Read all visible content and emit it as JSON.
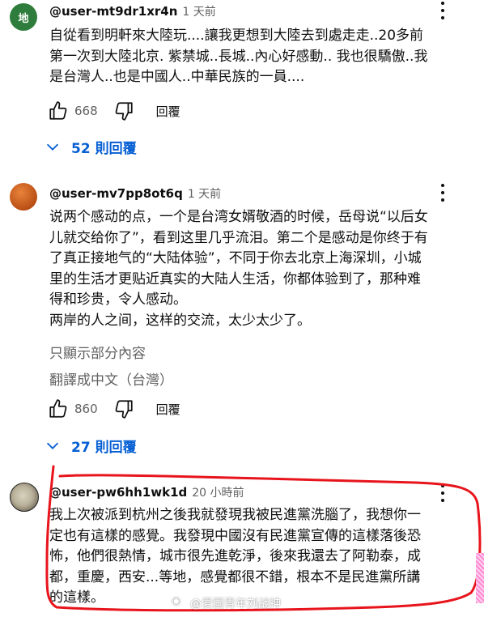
{
  "comments": [
    {
      "avatar_text": "地",
      "handle": "@user-mt9dr1xr4n",
      "time": "1 天前",
      "lines": [
        "自從看到明軒來大陸玩....讓我更想到大陸去到處走走..20多前",
        "第一次到大陸北京. 紫禁城..長城..內心好感動.. 我也很驕傲..我",
        "是台灣人..也是中國人..中華民族的一員...."
      ],
      "likes": "668",
      "reply_label": "回覆",
      "replies_label": "52 則回覆"
    },
    {
      "avatar_text": "",
      "handle": "@user-mv7pp8ot6q",
      "time": "1 天前",
      "lines": [
        "说两个感动的点，一个是台湾女婿敬酒的时候，岳母说“以后女",
        "儿就交给你了”，看到这里几乎流泪。第二个是感动是你终于有",
        "了真正接地气的“大陆体验”，不同于你去北京上海深圳，小城",
        "里的生活才更贴近真实的大陆人生活，你都体验到了，那种难",
        "得和珍贵，令人感动。",
        "两岸的人之间，这样的交流，太少太少了。"
      ],
      "show_less": "只顯示部分內容",
      "translate": "翻譯成中文（台灣）",
      "likes": "860",
      "reply_label": "回覆",
      "replies_label": "27 則回覆"
    },
    {
      "avatar_text": "",
      "handle": "@user-pw6hh1wk1d",
      "time": "20 小時前",
      "lines": [
        "我上次被派到杭州之後我就發現我被民進黨洗腦了，我想你一",
        "定也有這樣的感覺。我發現中國沒有民進黨宣傳的這樣落後恐",
        "怖，他們很熱情，城市很先進乾淨，後來我還去了阿勒泰，成",
        "都，重慶，西安...等地，感覺都很不錯，根本不是民進黨所講",
        "的這樣。"
      ]
    }
  ],
  "watermark": "@爱国青年刘战神"
}
